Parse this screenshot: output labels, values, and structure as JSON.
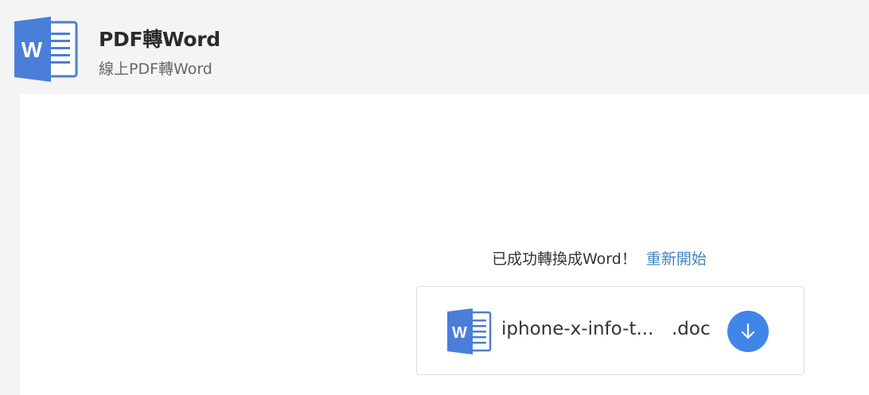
{
  "header": {
    "title": "PDF轉Word",
    "subtitle": "線上PDF轉Word",
    "logo_icon": "word-document-icon",
    "logo_letter": "W"
  },
  "result": {
    "message": "已成功轉換成Word！",
    "restart_label": "重新開始"
  },
  "file": {
    "icon": "word-document-icon",
    "icon_letter": "W",
    "name": "iphone-x-info-t...",
    "extension": ".doc",
    "download_icon": "download-arrow-icon"
  },
  "colors": {
    "page_background": "#f4f4f4",
    "content_background": "#ffffff",
    "word_blue": "#4a7ed8",
    "link_blue": "#3e84c6",
    "download_button": "#3f86e8"
  }
}
